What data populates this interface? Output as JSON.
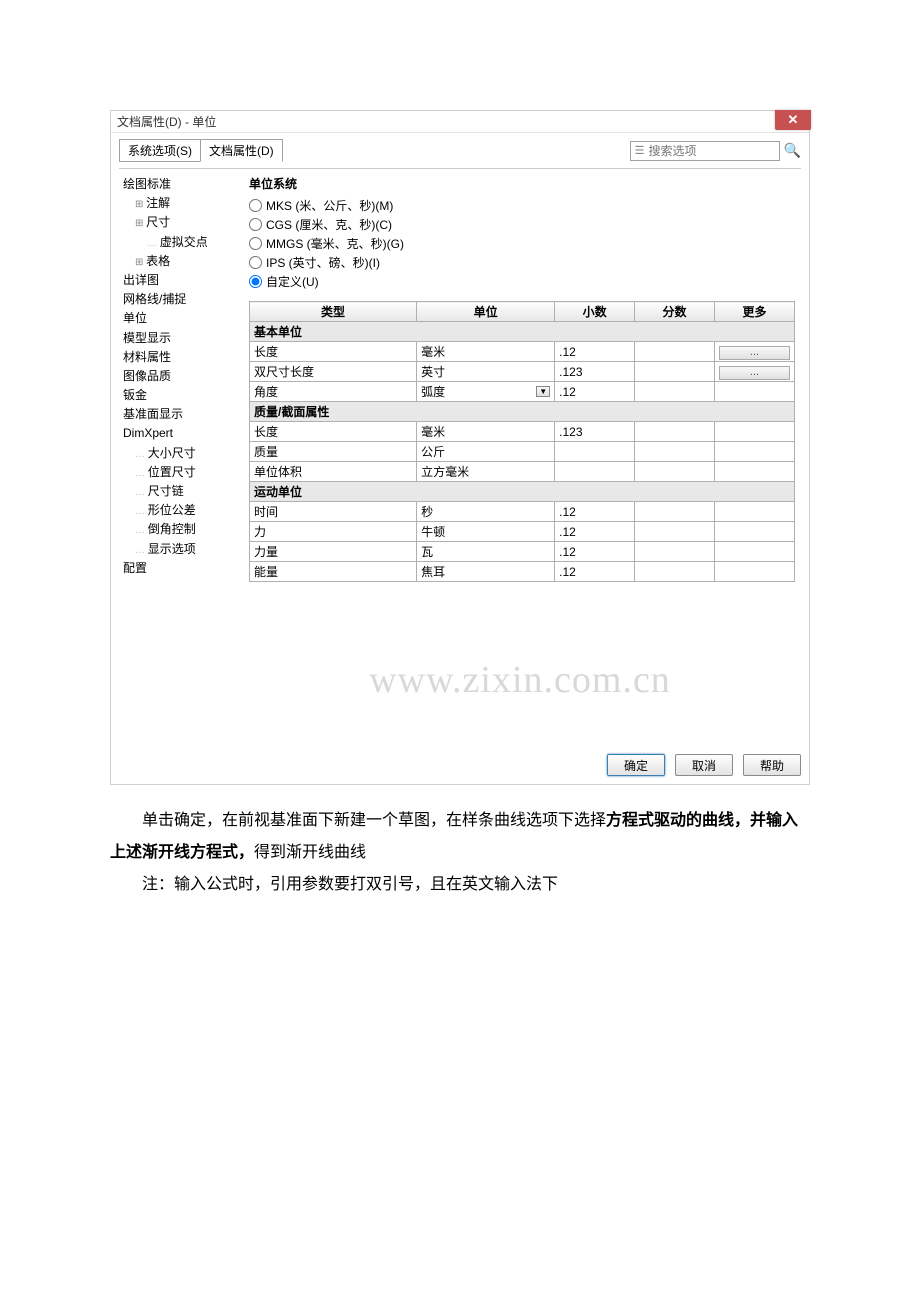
{
  "dialog": {
    "title": "文档属性(D) - 单位",
    "tabs": {
      "system": "系统选项(S)",
      "doc": "文档属性(D)"
    },
    "search_placeholder": "搜索选项",
    "tree": [
      {
        "label": "绘图标准",
        "cls": ""
      },
      {
        "label": "注解",
        "cls": "indent1 dot"
      },
      {
        "label": "尺寸",
        "cls": "indent1 dot"
      },
      {
        "label": "虚拟交点",
        "cls": "indent2 leaf"
      },
      {
        "label": "表格",
        "cls": "indent1 dot"
      },
      {
        "label": "出详图",
        "cls": ""
      },
      {
        "label": "网格线/捕捉",
        "cls": ""
      },
      {
        "label": "单位",
        "cls": ""
      },
      {
        "label": "模型显示",
        "cls": ""
      },
      {
        "label": "材料属性",
        "cls": ""
      },
      {
        "label": "图像品质",
        "cls": ""
      },
      {
        "label": "钣金",
        "cls": ""
      },
      {
        "label": "基准面显示",
        "cls": ""
      },
      {
        "label": "DimXpert",
        "cls": ""
      },
      {
        "label": "大小尺寸",
        "cls": "indent1 leaf"
      },
      {
        "label": "位置尺寸",
        "cls": "indent1 leaf"
      },
      {
        "label": "尺寸链",
        "cls": "indent1 leaf"
      },
      {
        "label": "形位公差",
        "cls": "indent1 leaf"
      },
      {
        "label": "倒角控制",
        "cls": "indent1 leaf"
      },
      {
        "label": "显示选项",
        "cls": "indent1 leaf"
      },
      {
        "label": "配置",
        "cls": ""
      }
    ],
    "unit_system": {
      "title": "单位系统",
      "options": [
        "MKS (米、公斤、秒)(M)",
        "CGS (厘米、克、秒)(C)",
        "MMGS (毫米、克、秒)(G)",
        "IPS (英寸、磅、秒)(I)",
        "自定义(U)"
      ],
      "selected_index": 4
    },
    "table": {
      "headers": [
        "类型",
        "单位",
        "小数",
        "分数",
        "更多"
      ],
      "sections": [
        {
          "title": "基本单位",
          "rows": [
            {
              "type": "长度",
              "unit": "毫米",
              "dec": ".12",
              "frac": "",
              "more": "..."
            },
            {
              "type": "双尺寸长度",
              "unit": "英寸",
              "dec": ".123",
              "frac": "",
              "more": "..."
            },
            {
              "type": "角度",
              "unit": "弧度",
              "dec": ".12",
              "frac": "",
              "more": "",
              "dropdown": true
            }
          ]
        },
        {
          "title": "质量/截面属性",
          "rows": [
            {
              "type": "长度",
              "unit": "毫米",
              "dec": ".123",
              "frac": "",
              "more": ""
            },
            {
              "type": "质量",
              "unit": "公斤",
              "dec": "",
              "frac": "",
              "more": ""
            },
            {
              "type": "单位体积",
              "unit": "立方毫米",
              "dec": "",
              "frac": "",
              "more": ""
            }
          ]
        },
        {
          "title": "运动单位",
          "rows": [
            {
              "type": "时间",
              "unit": "秒",
              "dec": ".12",
              "frac": "",
              "more": ""
            },
            {
              "type": "力",
              "unit": "牛顿",
              "dec": ".12",
              "frac": "",
              "more": ""
            },
            {
              "type": "力量",
              "unit": "瓦",
              "dec": ".12",
              "frac": "",
              "more": ""
            },
            {
              "type": "能量",
              "unit": "焦耳",
              "dec": ".12",
              "frac": "",
              "more": ""
            }
          ]
        }
      ]
    },
    "footer": {
      "ok": "确定",
      "cancel": "取消",
      "help": "帮助"
    }
  },
  "watermark": "www.zixin.com.cn",
  "body": {
    "p1a": "单击确定，在前视基准面下新建一个草图，在样条曲线选项下选择",
    "p1b": "方程式驱动的曲线，并输入上述渐开线方程式，",
    "p1c": "得到渐开线曲线",
    "p2": "注：输入公式时，引用参数要打双引号，且在英文输入法下"
  }
}
